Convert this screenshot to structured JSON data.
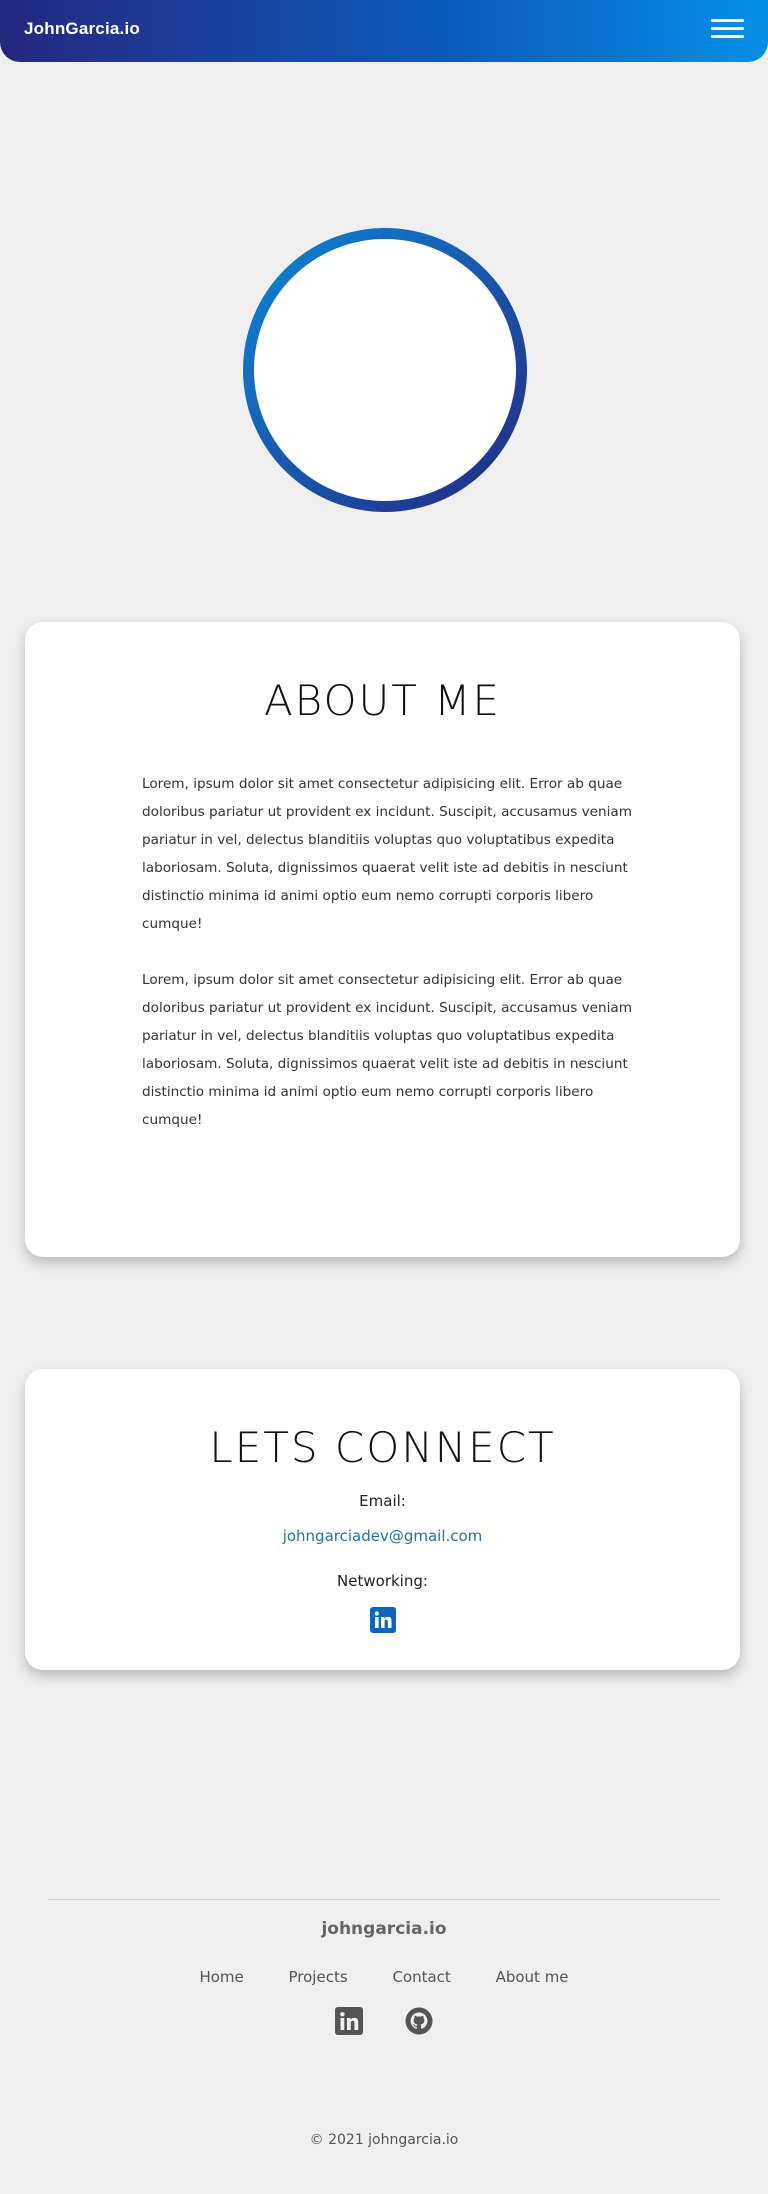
{
  "navbar": {
    "brand": "JohnGarcia.io",
    "menu_icon": "hamburger-menu-icon"
  },
  "profile": {
    "avatar": "profile-avatar"
  },
  "about": {
    "title": "ABOUT ME",
    "paragraphs": [
      "Lorem, ipsum dolor sit amet consectetur adipisicing elit. Error ab quae doloribus pariatur ut provident ex incidunt. Suscipit, accusamus veniam pariatur in vel, delectus blanditiis voluptas quo voluptatibus expedita laboriosam. Soluta, dignissimos quaerat velit iste ad debitis in nesciunt distinctio minima id animi optio eum nemo corrupti corporis libero cumque!",
      "Lorem, ipsum dolor sit amet consectetur adipisicing elit. Error ab quae doloribus pariatur ut provident ex incidunt. Suscipit, accusamus veniam pariatur in vel, delectus blanditiis voluptas quo voluptatibus expedita laboriosam. Soluta, dignissimos quaerat velit iste ad debitis in nesciunt distinctio minima id animi optio eum nemo corrupti corporis libero cumque!"
    ]
  },
  "connect": {
    "title": "LETS CONNECT",
    "email_label": "Email:",
    "email": "johngarciadev@gmail.com",
    "networking_label": "Networking:",
    "linkedin_icon": "linkedin-icon"
  },
  "footer": {
    "brand": "johngarcia.io",
    "nav": [
      "Home",
      "Projects",
      "Contact",
      "About me"
    ],
    "social_icons": [
      "linkedin-icon",
      "github-icon"
    ],
    "copyright": "© 2021 johngarcia.io"
  },
  "colors": {
    "nav_gradient_start": "#25287f",
    "nav_gradient_end": "#0690e5",
    "link_blue": "#1f6fbf",
    "linkedin_blue": "#0a66c2",
    "background": "#efefef"
  }
}
